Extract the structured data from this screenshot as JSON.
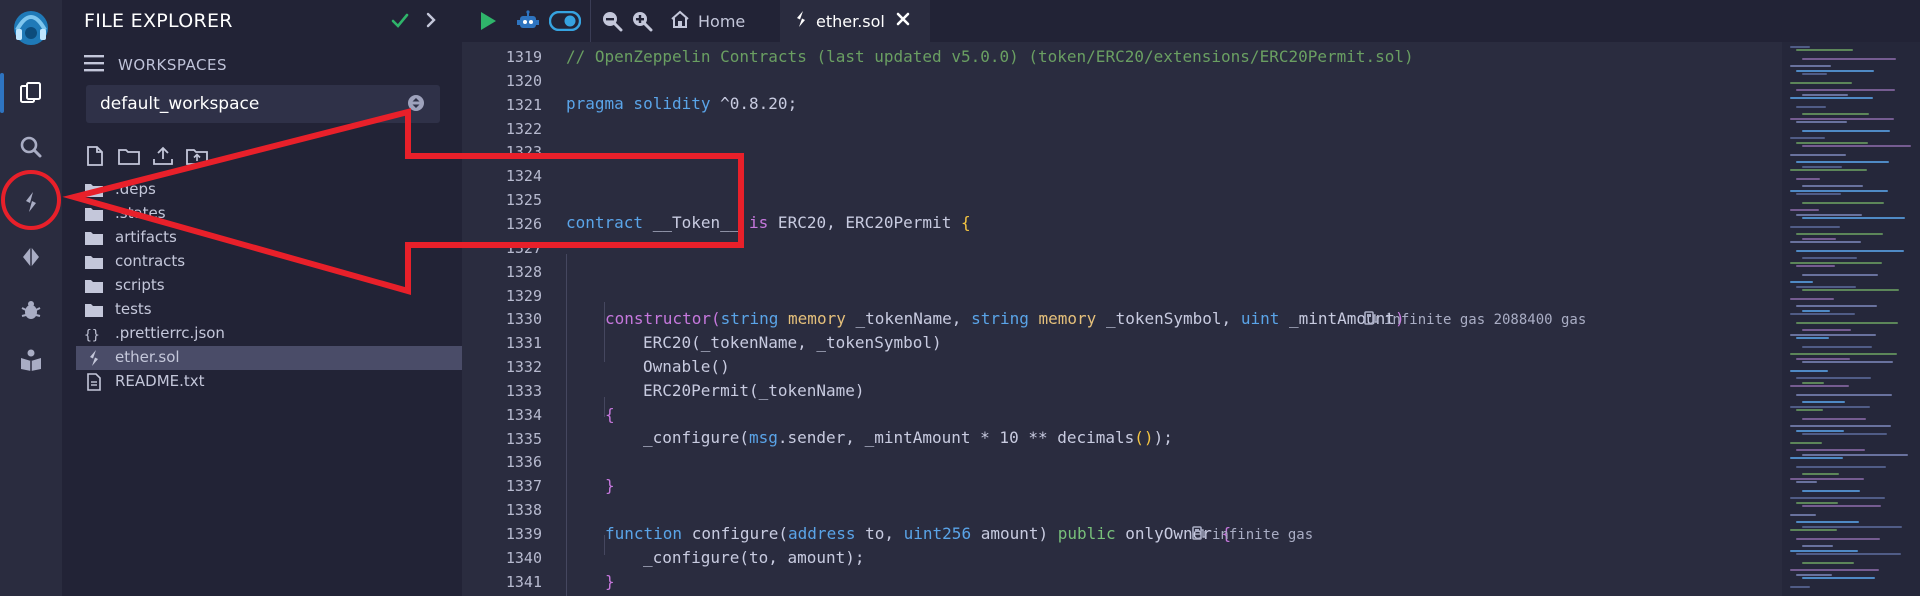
{
  "explorer": {
    "title": "FILE EXPLORER",
    "workspaces_label": "WORKSPACES",
    "workspace_selected": "default_workspace",
    "tree": [
      {
        "name": ".deps",
        "type": "folder"
      },
      {
        "name": ".states",
        "type": "folder"
      },
      {
        "name": "artifacts",
        "type": "folder"
      },
      {
        "name": "contracts",
        "type": "folder"
      },
      {
        "name": "scripts",
        "type": "folder"
      },
      {
        "name": "tests",
        "type": "folder"
      },
      {
        "name": ".prettierrc.json",
        "type": "json"
      },
      {
        "name": "ether.sol",
        "type": "sol",
        "selected": true
      },
      {
        "name": "README.txt",
        "type": "txt"
      }
    ]
  },
  "topbar": {
    "home_tab": "Home",
    "file_tab": "ether.sol"
  },
  "editor": {
    "line_numbers": [
      "1319",
      "1320",
      "1321",
      "1322",
      "1323",
      "1324",
      "1325",
      "1326",
      "1327",
      "1328",
      "1329",
      "1330",
      "1331",
      "1332",
      "1333",
      "1334",
      "1335",
      "1336",
      "1337",
      "1338",
      "1339",
      "1340",
      "1341"
    ],
    "l1319": "// OpenZeppelin Contracts (last updated v5.0.0) (token/ERC20/extensions/ERC20Permit.sol)",
    "l1321_kw": "pragma solidity",
    "l1321_rest": " ^0.8.20;",
    "l1326_kw": "contract",
    "l1326_name": " __Token__ ",
    "l1326_is": "is",
    "l1326_rest": " ERC20, ERC20Permit ",
    "l1326_brace": "{",
    "l1330_fn": "constructor",
    "l1330_p1": "(",
    "l1330_t1": "string",
    "l1330_m1": " memory",
    "l1330_a1": " _tokenName, ",
    "l1330_t2": "string",
    "l1330_m2": " memory",
    "l1330_a2": " _tokenSymbol, ",
    "l1330_t3": "uint",
    "l1330_a3": " _mintAmount",
    "l1330_p2": ")",
    "l1330_gas": "infinite gas 2088400 gas",
    "l1331": "ERC20(_tokenName, _tokenSymbol)",
    "l1332": "Ownable()",
    "l1333": "ERC20Permit(_tokenName)",
    "l1334": "{",
    "l1335_a": "_configure(",
    "l1335_msg": "msg",
    "l1335_b": ".sender, _mintAmount * 10 ** decimals",
    "l1335_c": "()",
    "l1335_d": ");",
    "l1337": "}",
    "l1339_kw": "function",
    "l1339_name": " configure(",
    "l1339_t1": "address",
    "l1339_a1": " to, ",
    "l1339_t2": "uint256",
    "l1339_a2": " amount) ",
    "l1339_pub": "public",
    "l1339_mod": " onlyOwner ",
    "l1339_brace": "{",
    "l1339_gas": "infinite gas",
    "l1340": "_configure(to, amount);",
    "l1341": "}"
  },
  "colors": {
    "annotation_red": "#e8202a",
    "accent_blue": "#2e74c0",
    "run_green": "#2fb46a",
    "check_green": "#2fb46a"
  }
}
